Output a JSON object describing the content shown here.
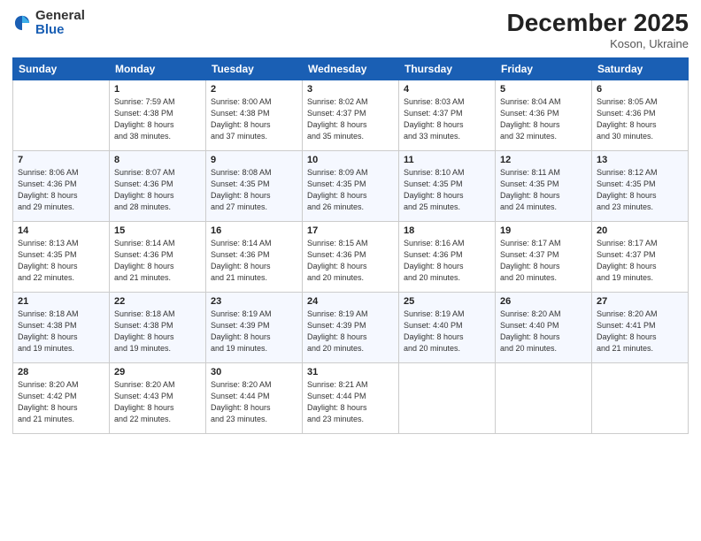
{
  "header": {
    "logo_general": "General",
    "logo_blue": "Blue",
    "month_year": "December 2025",
    "location": "Koson, Ukraine"
  },
  "days_of_week": [
    "Sunday",
    "Monday",
    "Tuesday",
    "Wednesday",
    "Thursday",
    "Friday",
    "Saturday"
  ],
  "weeks": [
    [
      {
        "date": "",
        "info": ""
      },
      {
        "date": "1",
        "info": "Sunrise: 7:59 AM\nSunset: 4:38 PM\nDaylight: 8 hours\nand 38 minutes."
      },
      {
        "date": "2",
        "info": "Sunrise: 8:00 AM\nSunset: 4:38 PM\nDaylight: 8 hours\nand 37 minutes."
      },
      {
        "date": "3",
        "info": "Sunrise: 8:02 AM\nSunset: 4:37 PM\nDaylight: 8 hours\nand 35 minutes."
      },
      {
        "date": "4",
        "info": "Sunrise: 8:03 AM\nSunset: 4:37 PM\nDaylight: 8 hours\nand 33 minutes."
      },
      {
        "date": "5",
        "info": "Sunrise: 8:04 AM\nSunset: 4:36 PM\nDaylight: 8 hours\nand 32 minutes."
      },
      {
        "date": "6",
        "info": "Sunrise: 8:05 AM\nSunset: 4:36 PM\nDaylight: 8 hours\nand 30 minutes."
      }
    ],
    [
      {
        "date": "7",
        "info": "Sunrise: 8:06 AM\nSunset: 4:36 PM\nDaylight: 8 hours\nand 29 minutes."
      },
      {
        "date": "8",
        "info": "Sunrise: 8:07 AM\nSunset: 4:36 PM\nDaylight: 8 hours\nand 28 minutes."
      },
      {
        "date": "9",
        "info": "Sunrise: 8:08 AM\nSunset: 4:35 PM\nDaylight: 8 hours\nand 27 minutes."
      },
      {
        "date": "10",
        "info": "Sunrise: 8:09 AM\nSunset: 4:35 PM\nDaylight: 8 hours\nand 26 minutes."
      },
      {
        "date": "11",
        "info": "Sunrise: 8:10 AM\nSunset: 4:35 PM\nDaylight: 8 hours\nand 25 minutes."
      },
      {
        "date": "12",
        "info": "Sunrise: 8:11 AM\nSunset: 4:35 PM\nDaylight: 8 hours\nand 24 minutes."
      },
      {
        "date": "13",
        "info": "Sunrise: 8:12 AM\nSunset: 4:35 PM\nDaylight: 8 hours\nand 23 minutes."
      }
    ],
    [
      {
        "date": "14",
        "info": "Sunrise: 8:13 AM\nSunset: 4:35 PM\nDaylight: 8 hours\nand 22 minutes."
      },
      {
        "date": "15",
        "info": "Sunrise: 8:14 AM\nSunset: 4:36 PM\nDaylight: 8 hours\nand 21 minutes."
      },
      {
        "date": "16",
        "info": "Sunrise: 8:14 AM\nSunset: 4:36 PM\nDaylight: 8 hours\nand 21 minutes."
      },
      {
        "date": "17",
        "info": "Sunrise: 8:15 AM\nSunset: 4:36 PM\nDaylight: 8 hours\nand 20 minutes."
      },
      {
        "date": "18",
        "info": "Sunrise: 8:16 AM\nSunset: 4:36 PM\nDaylight: 8 hours\nand 20 minutes."
      },
      {
        "date": "19",
        "info": "Sunrise: 8:17 AM\nSunset: 4:37 PM\nDaylight: 8 hours\nand 20 minutes."
      },
      {
        "date": "20",
        "info": "Sunrise: 8:17 AM\nSunset: 4:37 PM\nDaylight: 8 hours\nand 19 minutes."
      }
    ],
    [
      {
        "date": "21",
        "info": "Sunrise: 8:18 AM\nSunset: 4:38 PM\nDaylight: 8 hours\nand 19 minutes."
      },
      {
        "date": "22",
        "info": "Sunrise: 8:18 AM\nSunset: 4:38 PM\nDaylight: 8 hours\nand 19 minutes."
      },
      {
        "date": "23",
        "info": "Sunrise: 8:19 AM\nSunset: 4:39 PM\nDaylight: 8 hours\nand 19 minutes."
      },
      {
        "date": "24",
        "info": "Sunrise: 8:19 AM\nSunset: 4:39 PM\nDaylight: 8 hours\nand 20 minutes."
      },
      {
        "date": "25",
        "info": "Sunrise: 8:19 AM\nSunset: 4:40 PM\nDaylight: 8 hours\nand 20 minutes."
      },
      {
        "date": "26",
        "info": "Sunrise: 8:20 AM\nSunset: 4:40 PM\nDaylight: 8 hours\nand 20 minutes."
      },
      {
        "date": "27",
        "info": "Sunrise: 8:20 AM\nSunset: 4:41 PM\nDaylight: 8 hours\nand 21 minutes."
      }
    ],
    [
      {
        "date": "28",
        "info": "Sunrise: 8:20 AM\nSunset: 4:42 PM\nDaylight: 8 hours\nand 21 minutes."
      },
      {
        "date": "29",
        "info": "Sunrise: 8:20 AM\nSunset: 4:43 PM\nDaylight: 8 hours\nand 22 minutes."
      },
      {
        "date": "30",
        "info": "Sunrise: 8:20 AM\nSunset: 4:44 PM\nDaylight: 8 hours\nand 23 minutes."
      },
      {
        "date": "31",
        "info": "Sunrise: 8:21 AM\nSunset: 4:44 PM\nDaylight: 8 hours\nand 23 minutes."
      },
      {
        "date": "",
        "info": ""
      },
      {
        "date": "",
        "info": ""
      },
      {
        "date": "",
        "info": ""
      }
    ]
  ]
}
